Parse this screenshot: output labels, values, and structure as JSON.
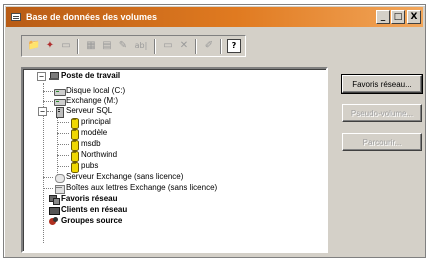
{
  "window": {
    "title": "Base de données des volumes",
    "icon": "window-app-icon",
    "controls": [
      "_",
      "□",
      "X"
    ]
  },
  "toolbar": {
    "buttons": [
      {
        "name": "open-folder",
        "icon": "📁",
        "enabled": true
      },
      {
        "name": "new-item",
        "icon": "✦",
        "enabled": true
      },
      {
        "name": "scan",
        "icon": "▭",
        "enabled": false
      },
      {
        "name": "view-1",
        "icon": "▦",
        "enabled": false
      },
      {
        "name": "view-2",
        "icon": "▤",
        "enabled": false
      },
      {
        "name": "link",
        "icon": "✎",
        "enabled": false
      },
      {
        "name": "rename",
        "icon": "ab|",
        "enabled": false
      },
      {
        "name": "properties",
        "icon": "▭",
        "enabled": false
      },
      {
        "name": "delete",
        "icon": "✕",
        "enabled": false
      },
      {
        "name": "edit",
        "icon": "✐",
        "enabled": false
      },
      {
        "name": "help",
        "icon": "?",
        "enabled": true
      }
    ]
  },
  "tree": {
    "root": {
      "label": "Poste de travail",
      "icon": "computer-icon",
      "expander": "−"
    },
    "disque_local": {
      "label": "Disque local (C:)",
      "icon": "drive-icon"
    },
    "exchange_m": {
      "label": "Exchange (M:)",
      "icon": "drive-icon"
    },
    "serveur_sql": {
      "label": "Serveur SQL",
      "icon": "server-icon",
      "expander": "−"
    },
    "databases": [
      {
        "label": "principal",
        "icon": "database-icon"
      },
      {
        "label": "modèle",
        "icon": "database-icon"
      },
      {
        "label": "msdb",
        "icon": "database-icon"
      },
      {
        "label": "Northwind",
        "icon": "database-icon"
      },
      {
        "label": "pubs",
        "icon": "database-icon"
      }
    ],
    "serveur_exchange": {
      "label": "Serveur Exchange (sans licence)",
      "icon": "exchange-server-icon"
    },
    "boites_exchange": {
      "label": "Boîtes aux lettres Exchange (sans licence)",
      "icon": "mailbox-icon"
    },
    "favoris": {
      "label": "Favoris réseau",
      "icon": "network-favorites-icon"
    },
    "clients": {
      "label": "Clients en réseau",
      "icon": "network-clients-icon"
    },
    "groupes": {
      "label": "Groupes source",
      "icon": "source-groups-icon"
    }
  },
  "side_buttons": {
    "favoris": {
      "label": "Favoris réseau...",
      "enabled": true
    },
    "pseudo_volume": {
      "label": "Pseudo-volume...",
      "enabled": false
    },
    "parcourir": {
      "label": "Parcourir...",
      "enabled": false
    }
  }
}
